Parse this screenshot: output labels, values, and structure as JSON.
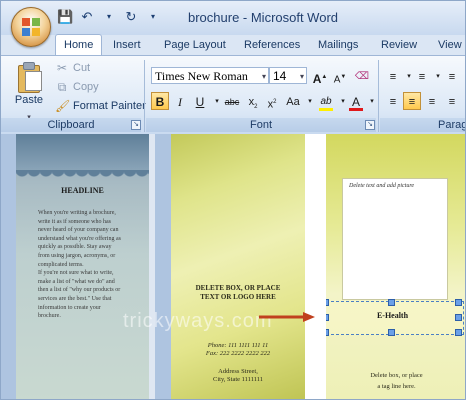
{
  "window": {
    "title": "brochure - Microsoft Word"
  },
  "tabs": [
    "Home",
    "Insert",
    "Page Layout",
    "References",
    "Mailings",
    "Review",
    "View"
  ],
  "clipboard": {
    "paste": "Paste",
    "cut": "Cut",
    "copy": "Copy",
    "format_painter": "Format Painter",
    "label": "Clipboard"
  },
  "font": {
    "name": "Times New Roman",
    "size": "14",
    "label": "Font"
  },
  "paragraph": {
    "label": "Parag"
  },
  "document": {
    "watermark": "trickyways.com",
    "panel1": {
      "headline": "HEADLINE",
      "body": [
        "When you're writing a brochure,",
        "write it as if someone who has",
        "never heard of your company can",
        "understand what you're offering as",
        "quickly as possible. Stay away",
        "from using jargon, acronyms, or",
        "complicated terms.",
        "If you're not sure what to write,",
        "make a list of \"what we do\" and",
        "then a list of \"why our products or",
        "services are the best.\" Use that",
        "information to create your",
        "brochure."
      ]
    },
    "panel2": {
      "delete_text": [
        "DELETE BOX, OR PLACE",
        "TEXT OR LOGO HERE"
      ],
      "phone": "Phone: 111 1111 111 11",
      "fax": "Fax: 222 2222 2222 222",
      "address": [
        "Address Street,",
        "City, State 1111111"
      ]
    },
    "panel3": {
      "picture_hint": "Delete text and add picture",
      "selected_text": "E-Health",
      "tagline": [
        "Delete box, or place",
        "a tag line here."
      ]
    }
  },
  "colors": {
    "arrow": "#c0401e",
    "selection": "#4a7fc4"
  }
}
